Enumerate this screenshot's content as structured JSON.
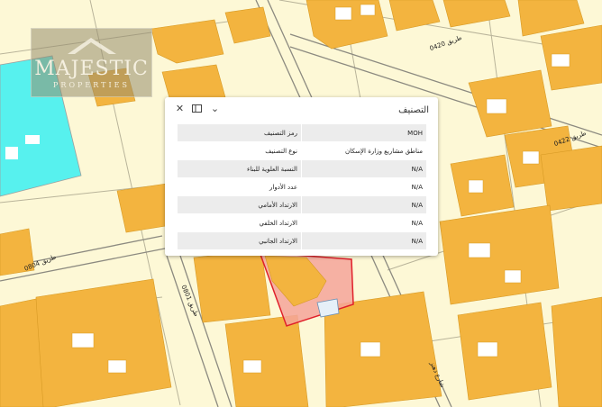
{
  "logo": {
    "name": "MAJESTIC",
    "subtitle": "PROPERTIES"
  },
  "popup": {
    "title": "التصنيف",
    "rows": [
      {
        "label": "رمز التصنيف",
        "value": "MOH"
      },
      {
        "label": "نوع التصنيف",
        "value": "مناطق مشاريع وزارة الإسكان"
      },
      {
        "label": "النسبة العلوية للبناء",
        "value": "N/A"
      },
      {
        "label": "عدد الأدوار",
        "value": "N/A"
      },
      {
        "label": "الارتداد الأمامي",
        "value": "N/A"
      },
      {
        "label": "الارتداد الخلفي",
        "value": "N/A"
      },
      {
        "label": "الارتداد الجانبي",
        "value": "N/A"
      }
    ]
  },
  "roads": {
    "r0420": "طريق 0420",
    "r0422": "طريق 0422",
    "r0804": "طريق 0804",
    "r0801": "طريق 0801",
    "street": "شارع دهنز"
  },
  "colors": {
    "building": "#f3b43f",
    "parcel": "#fdf8d6",
    "cyan_zone": "#57f1ee",
    "selected": "#f4a59a",
    "selected_border": "#e0202a"
  },
  "icons": {
    "close": "close-icon",
    "dock": "dock-icon",
    "collapse": "chevron-down-icon"
  }
}
